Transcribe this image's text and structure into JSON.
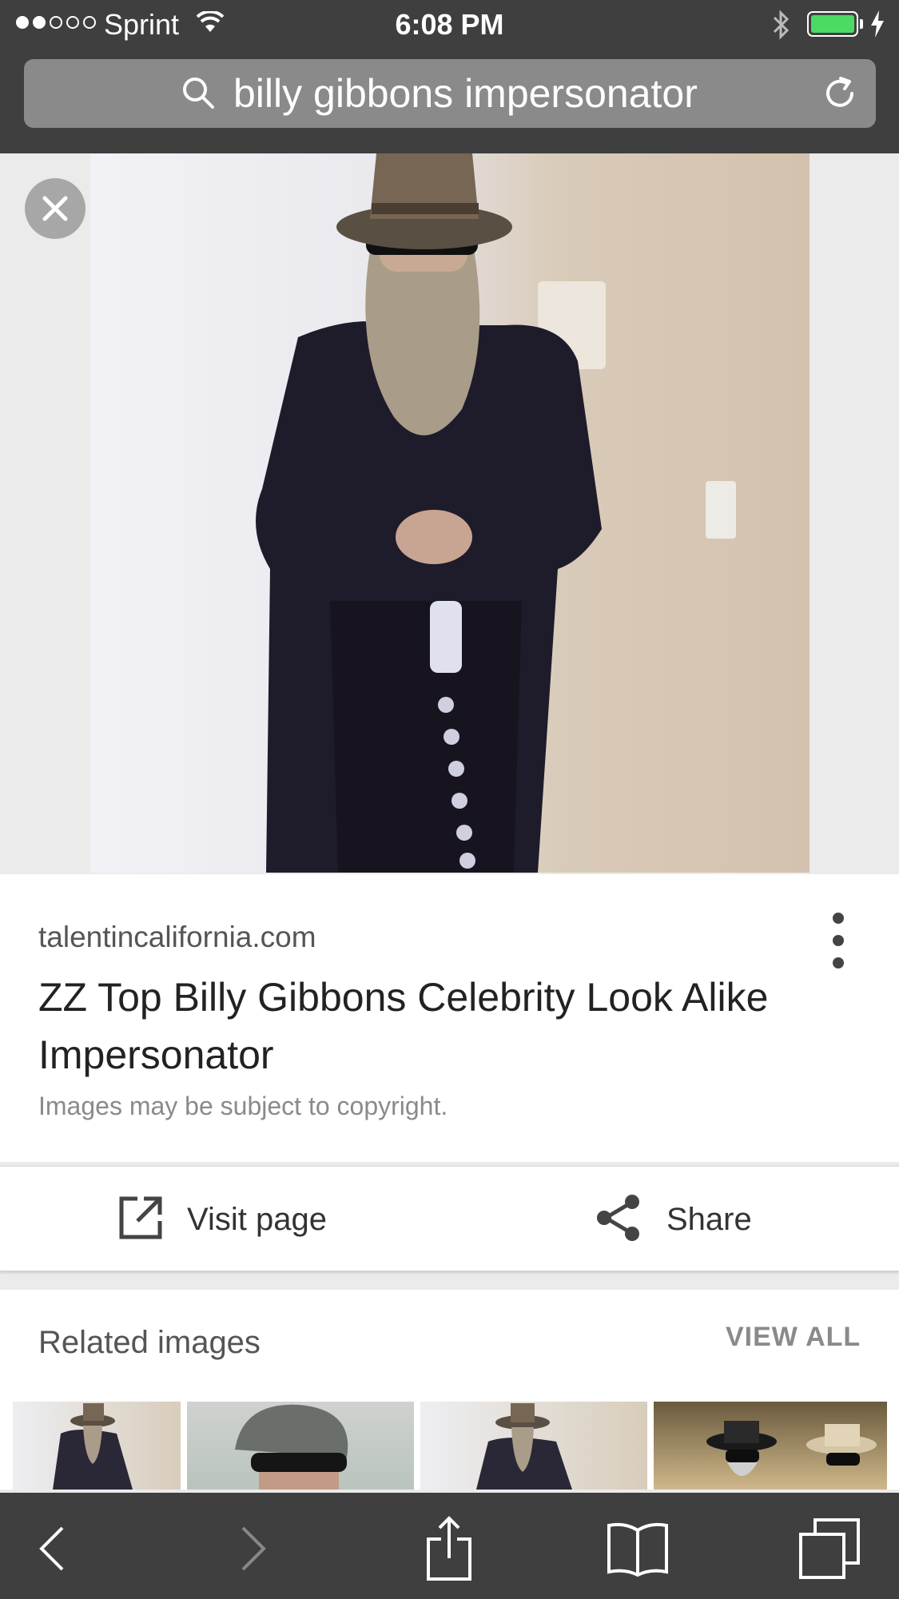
{
  "status_bar": {
    "signal_dots_filled": 2,
    "signal_dots_total": 5,
    "carrier": "Sprint",
    "time": "6:08 PM",
    "battery_color": "#4cd964"
  },
  "browser": {
    "search_query": "billy gibbons impersonator",
    "icons": [
      "search-icon",
      "reload-icon"
    ]
  },
  "result": {
    "domain": "talentincalifornia.com",
    "title": "ZZ Top Billy Gibbons Celebrity Look Alike Impersonator",
    "copyright_note": "Images may be subject to copyright.",
    "actions": {
      "visit_label": "Visit page",
      "share_label": "Share"
    }
  },
  "related": {
    "title": "Related images",
    "view_all_label": "VIEW ALL",
    "thumbnail_count": 4
  },
  "toolbar": {
    "buttons": [
      "back-icon",
      "forward-icon",
      "share-icon",
      "bookmarks-icon",
      "tabs-icon"
    ]
  }
}
